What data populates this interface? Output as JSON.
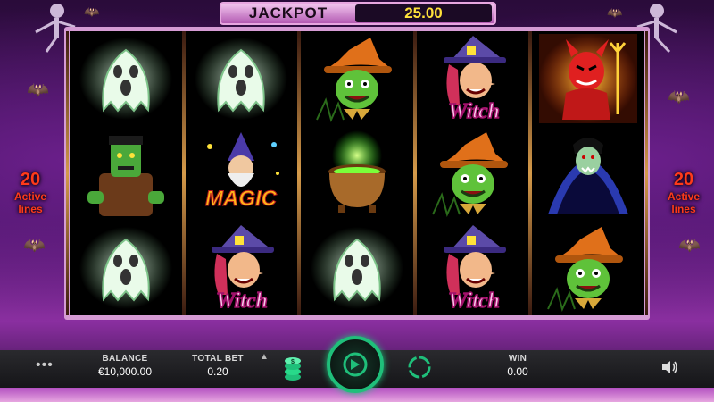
{
  "jackpot": {
    "label": "JACKPOT",
    "value": "25.00"
  },
  "active_lines": {
    "count": "20",
    "line1": "Active",
    "line2": "lines"
  },
  "reels": [
    [
      "ghost",
      "frankenstein",
      "ghost"
    ],
    [
      "ghost",
      "magic",
      "witch"
    ],
    [
      "scarecrow",
      "cauldron",
      "ghost"
    ],
    [
      "witch",
      "scarecrow",
      "witch"
    ],
    [
      "devil",
      "vampire",
      "scarecrow"
    ]
  ],
  "symbol_text": {
    "witch": "Witch",
    "magic": "MAGIC"
  },
  "controls": {
    "menu": "•••",
    "balance_label": "BALANCE",
    "balance_value": "€10,000.00",
    "total_bet_label": "TOTAL BET",
    "total_bet_value": "0.20",
    "win_label": "WIN",
    "win_value": "0.00"
  },
  "icons": [
    "menu-icon",
    "coin-stack-icon",
    "spin-icon",
    "autoplay-icon",
    "sound-icon",
    "chevron-up-icon"
  ],
  "colors": {
    "accent": "#1fbf7a",
    "jackpot_value": "#ffe23a",
    "lines_text": "#ff3a1a"
  }
}
